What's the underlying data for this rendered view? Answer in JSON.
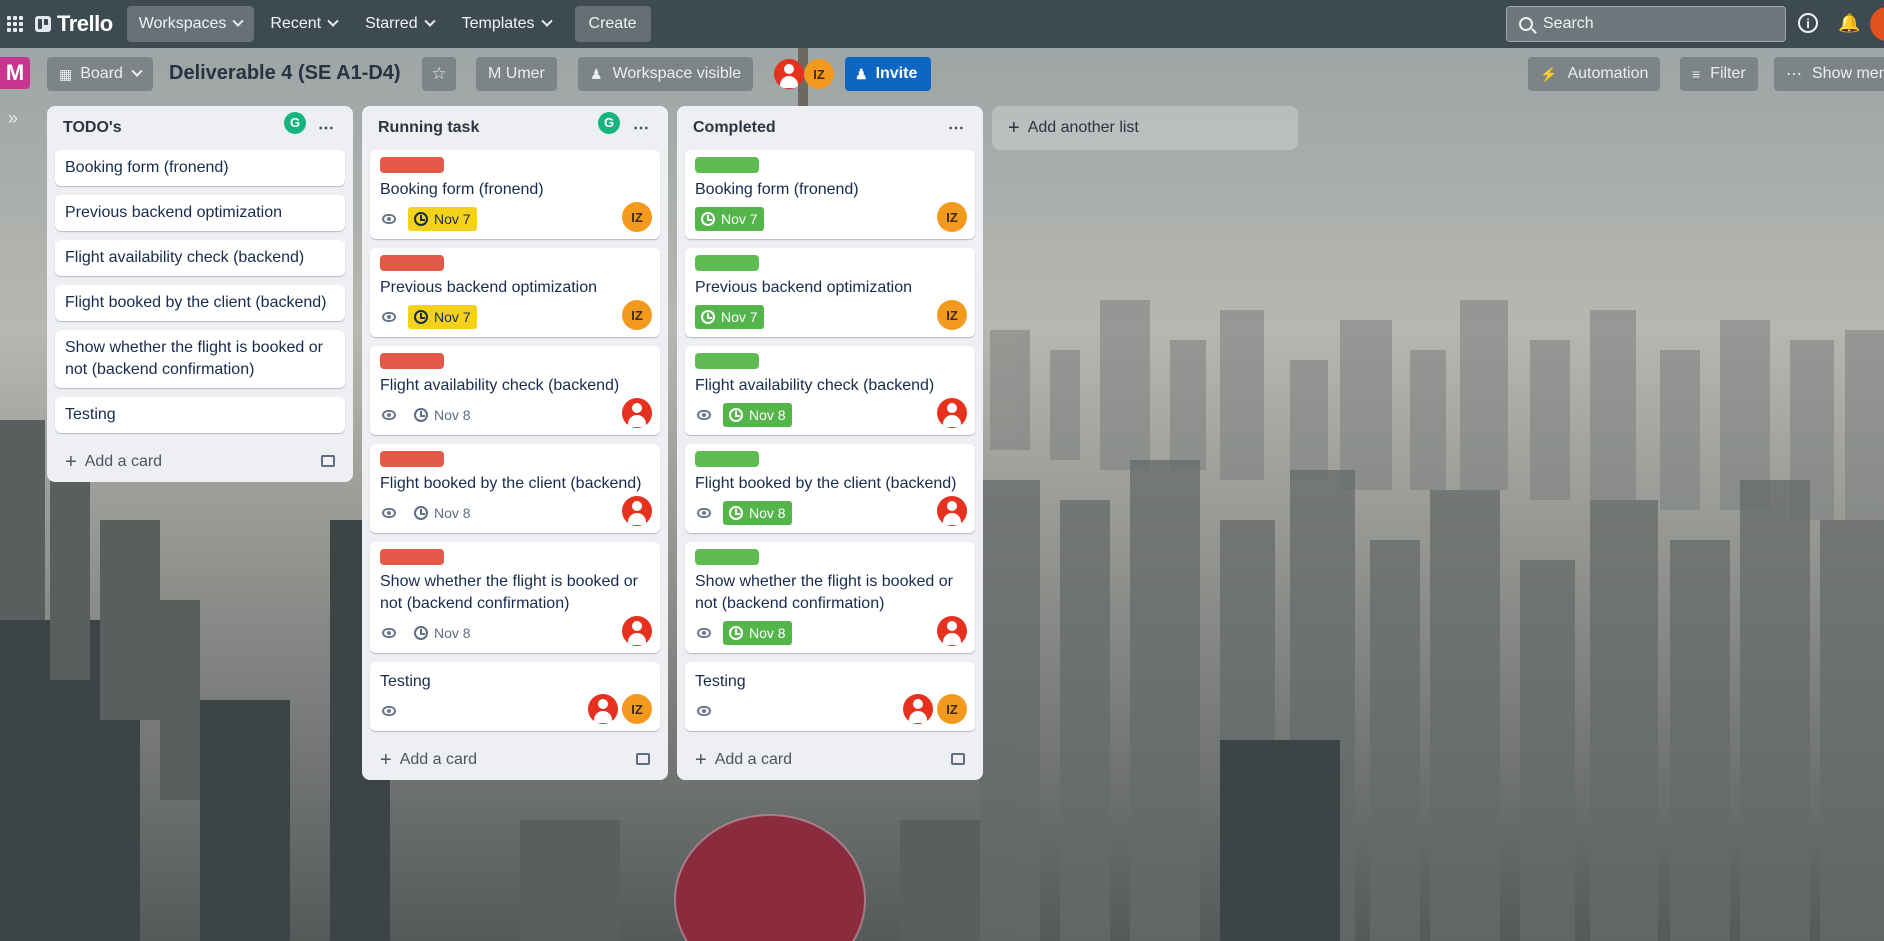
{
  "nav": {
    "logo": "Trello",
    "workspaces": "Workspaces",
    "recent": "Recent",
    "starred": "Starred",
    "templates": "Templates",
    "create": "Create",
    "search_placeholder": "Search"
  },
  "board": {
    "workspace_initial": "M",
    "view": "Board",
    "title": "Deliverable 4 (SE A1-D4)",
    "owner": "M Umer",
    "visibility": "Workspace visible",
    "member_initials": "IZ",
    "invite": "Invite",
    "automation": "Automation",
    "filter": "Filter",
    "show_menu": "Show menu"
  },
  "lists": [
    {
      "title": "TODO's",
      "badge": "G",
      "cards": [
        {
          "title": "Booking form (fronend)"
        },
        {
          "title": "Previous backend optimization"
        },
        {
          "title": "Flight availability check (backend)"
        },
        {
          "title": "Flight booked by the client (backend)"
        },
        {
          "title": "Show whether the flight is booked or not (backend confirmation)"
        },
        {
          "title": "Testing"
        }
      ],
      "add_card": "Add a card"
    },
    {
      "title": "Running task",
      "badge": "G",
      "cards": [
        {
          "title": "Booking form (fronend)",
          "label": "red",
          "due": "Nov 7",
          "due_style": "yellow",
          "members": [
            "IZ"
          ]
        },
        {
          "title": "Previous backend optimization",
          "label": "red",
          "due": "Nov 7",
          "due_style": "yellow",
          "members": [
            "IZ"
          ]
        },
        {
          "title": "Flight availability check (backend)",
          "label": "red",
          "due": "Nov 8",
          "due_style": "plain",
          "members": [
            "red"
          ]
        },
        {
          "title": "Flight booked by the client (backend)",
          "label": "red",
          "due": "Nov 8",
          "due_style": "plain",
          "members": [
            "red"
          ]
        },
        {
          "title": "Show whether the flight is booked or not (backend confirmation)",
          "label": "red",
          "due": "Nov 8",
          "due_style": "plain",
          "members": [
            "red"
          ]
        },
        {
          "title": "Testing",
          "members": [
            "red",
            "IZ"
          ]
        }
      ],
      "add_card": "Add a card"
    },
    {
      "title": "Completed",
      "cards": [
        {
          "title": "Booking form (fronend)",
          "label": "green",
          "due": "Nov 7",
          "due_style": "green",
          "members": [
            "IZ"
          ]
        },
        {
          "title": "Previous backend optimization",
          "label": "green",
          "due": "Nov 7",
          "due_style": "green",
          "members": [
            "IZ"
          ]
        },
        {
          "title": "Flight availability check (backend)",
          "label": "green",
          "due": "Nov 8",
          "due_style": "green",
          "members": [
            "red"
          ]
        },
        {
          "title": "Flight booked by the client (backend)",
          "label": "green",
          "due": "Nov 8",
          "due_style": "green",
          "members": [
            "red"
          ]
        },
        {
          "title": "Show whether the flight is booked or not (backend confirmation)",
          "label": "green",
          "due": "Nov 8",
          "due_style": "green",
          "members": [
            "red"
          ]
        },
        {
          "title": "Testing",
          "members": [
            "red",
            "IZ"
          ]
        }
      ],
      "add_card": "Add a card"
    }
  ],
  "add_list": "Add another list",
  "colors": {
    "label_red": "#e35a48",
    "label_green": "#5fbc52",
    "due_yellow": "#f4d21b",
    "due_green": "#54b54a",
    "invite_blue": "#0c66c2",
    "workspace_pink": "#c6358e",
    "member_orange": "#f39a1e",
    "member_red": "#e6311f"
  },
  "icons": [
    "apps-grid-icon",
    "trello-logo-icon",
    "search-icon",
    "info-icon",
    "bell-icon",
    "board-view-icon",
    "star-icon",
    "visibility-icon",
    "invite-icon",
    "automation-icon",
    "filter-icon",
    "more-icon",
    "eye-icon",
    "clock-icon",
    "template-icon",
    "plus-icon",
    "sidebar-expand-icon"
  ]
}
